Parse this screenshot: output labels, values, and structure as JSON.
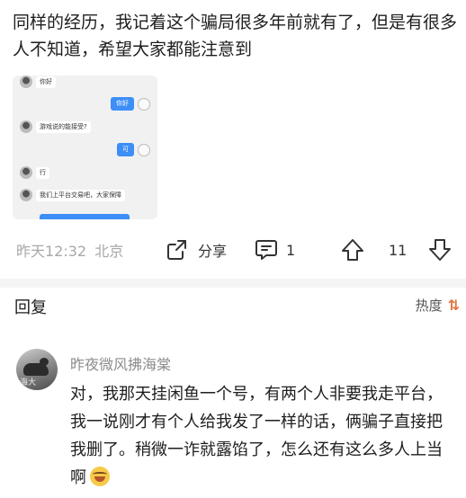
{
  "post": {
    "text": "同样的经历，我记着这个骗局很多年前就有了，但是有很多人不知道，希望大家都能注意到"
  },
  "chat_image": {
    "messages": [
      {
        "side": "left",
        "text": "你好"
      },
      {
        "side": "right",
        "text": "你好"
      },
      {
        "side": "left",
        "text": "游戏说的能接受?"
      },
      {
        "side": "right",
        "text": "可"
      },
      {
        "side": "left",
        "text": "行"
      },
      {
        "side": "left",
        "text": "我们上平台交易吧，大家保障"
      }
    ]
  },
  "actions": {
    "timestamp": "昨天12:32",
    "location": "北京",
    "share_label": "分享",
    "comment_count": "1",
    "vote_count": "11"
  },
  "replies": {
    "title": "回复",
    "sort_label": "热度",
    "sort_icon": "⇅"
  },
  "comment": {
    "username": "昨夜微风拂海棠",
    "avatar_watermark": "海大",
    "text": "对，我那天挂闲鱼一个号，有两个人非要我走平台，我一说刚才有个人给我发了一样的话，俩骗子直接把我删了。稍微一诈就露馅了，怎么还有这么多人上当啊",
    "emoji": "laughing-emoji"
  },
  "colors": {
    "chat_bubble": "#3d8ef6",
    "sort_icon": "#e0743f",
    "meta_text": "#a8a8a8",
    "username_text": "#8c8c8c"
  }
}
